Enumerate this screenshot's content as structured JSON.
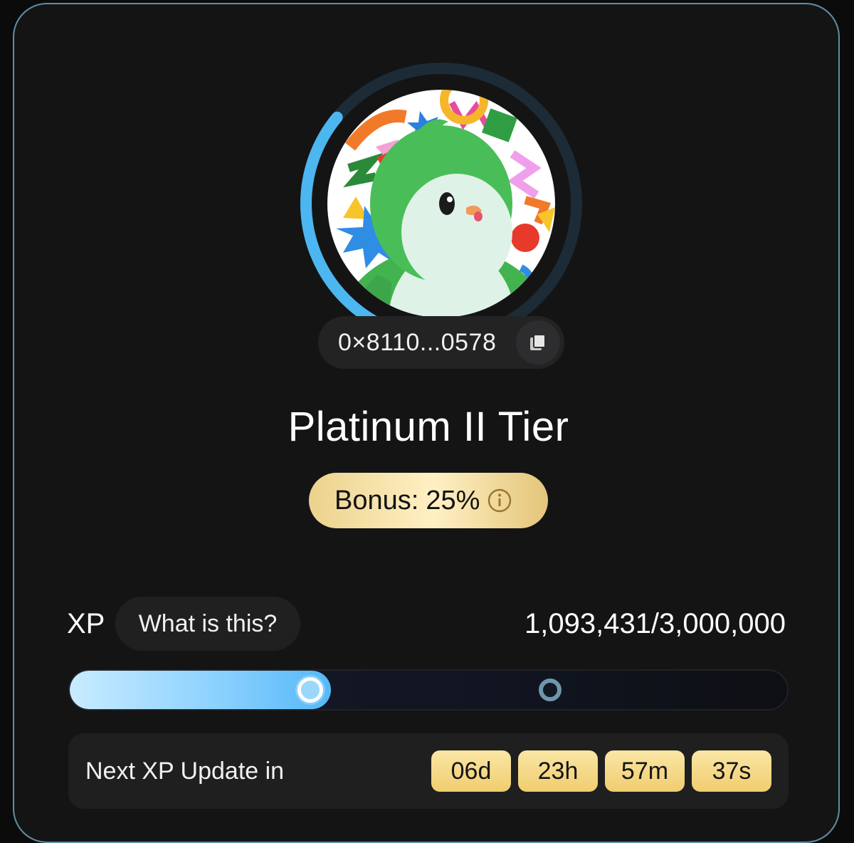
{
  "profile": {
    "avatar_alt": "green penguin avatar",
    "level_ring_progress": 0.36,
    "address": "0×8110...0578",
    "copy_icon": "copy-icon"
  },
  "tier": {
    "title": "Platinum II Tier"
  },
  "bonus": {
    "label": "Bonus:",
    "value": "25%",
    "info_icon": "info-icon"
  },
  "xp": {
    "label": "XP",
    "what_button": "What is this?",
    "value": "1,093,431/3,000,000",
    "progress": 0.364,
    "milestone_progress": 0.67
  },
  "next_update": {
    "label": "Next XP Update in",
    "days": "06d",
    "hours": "23h",
    "minutes": "57m",
    "seconds": "37s"
  },
  "colors": {
    "accent_blue": "#55b8f7",
    "gold": "#f0cd6f",
    "card_border": "#5f8ea2",
    "background": "#141415"
  }
}
